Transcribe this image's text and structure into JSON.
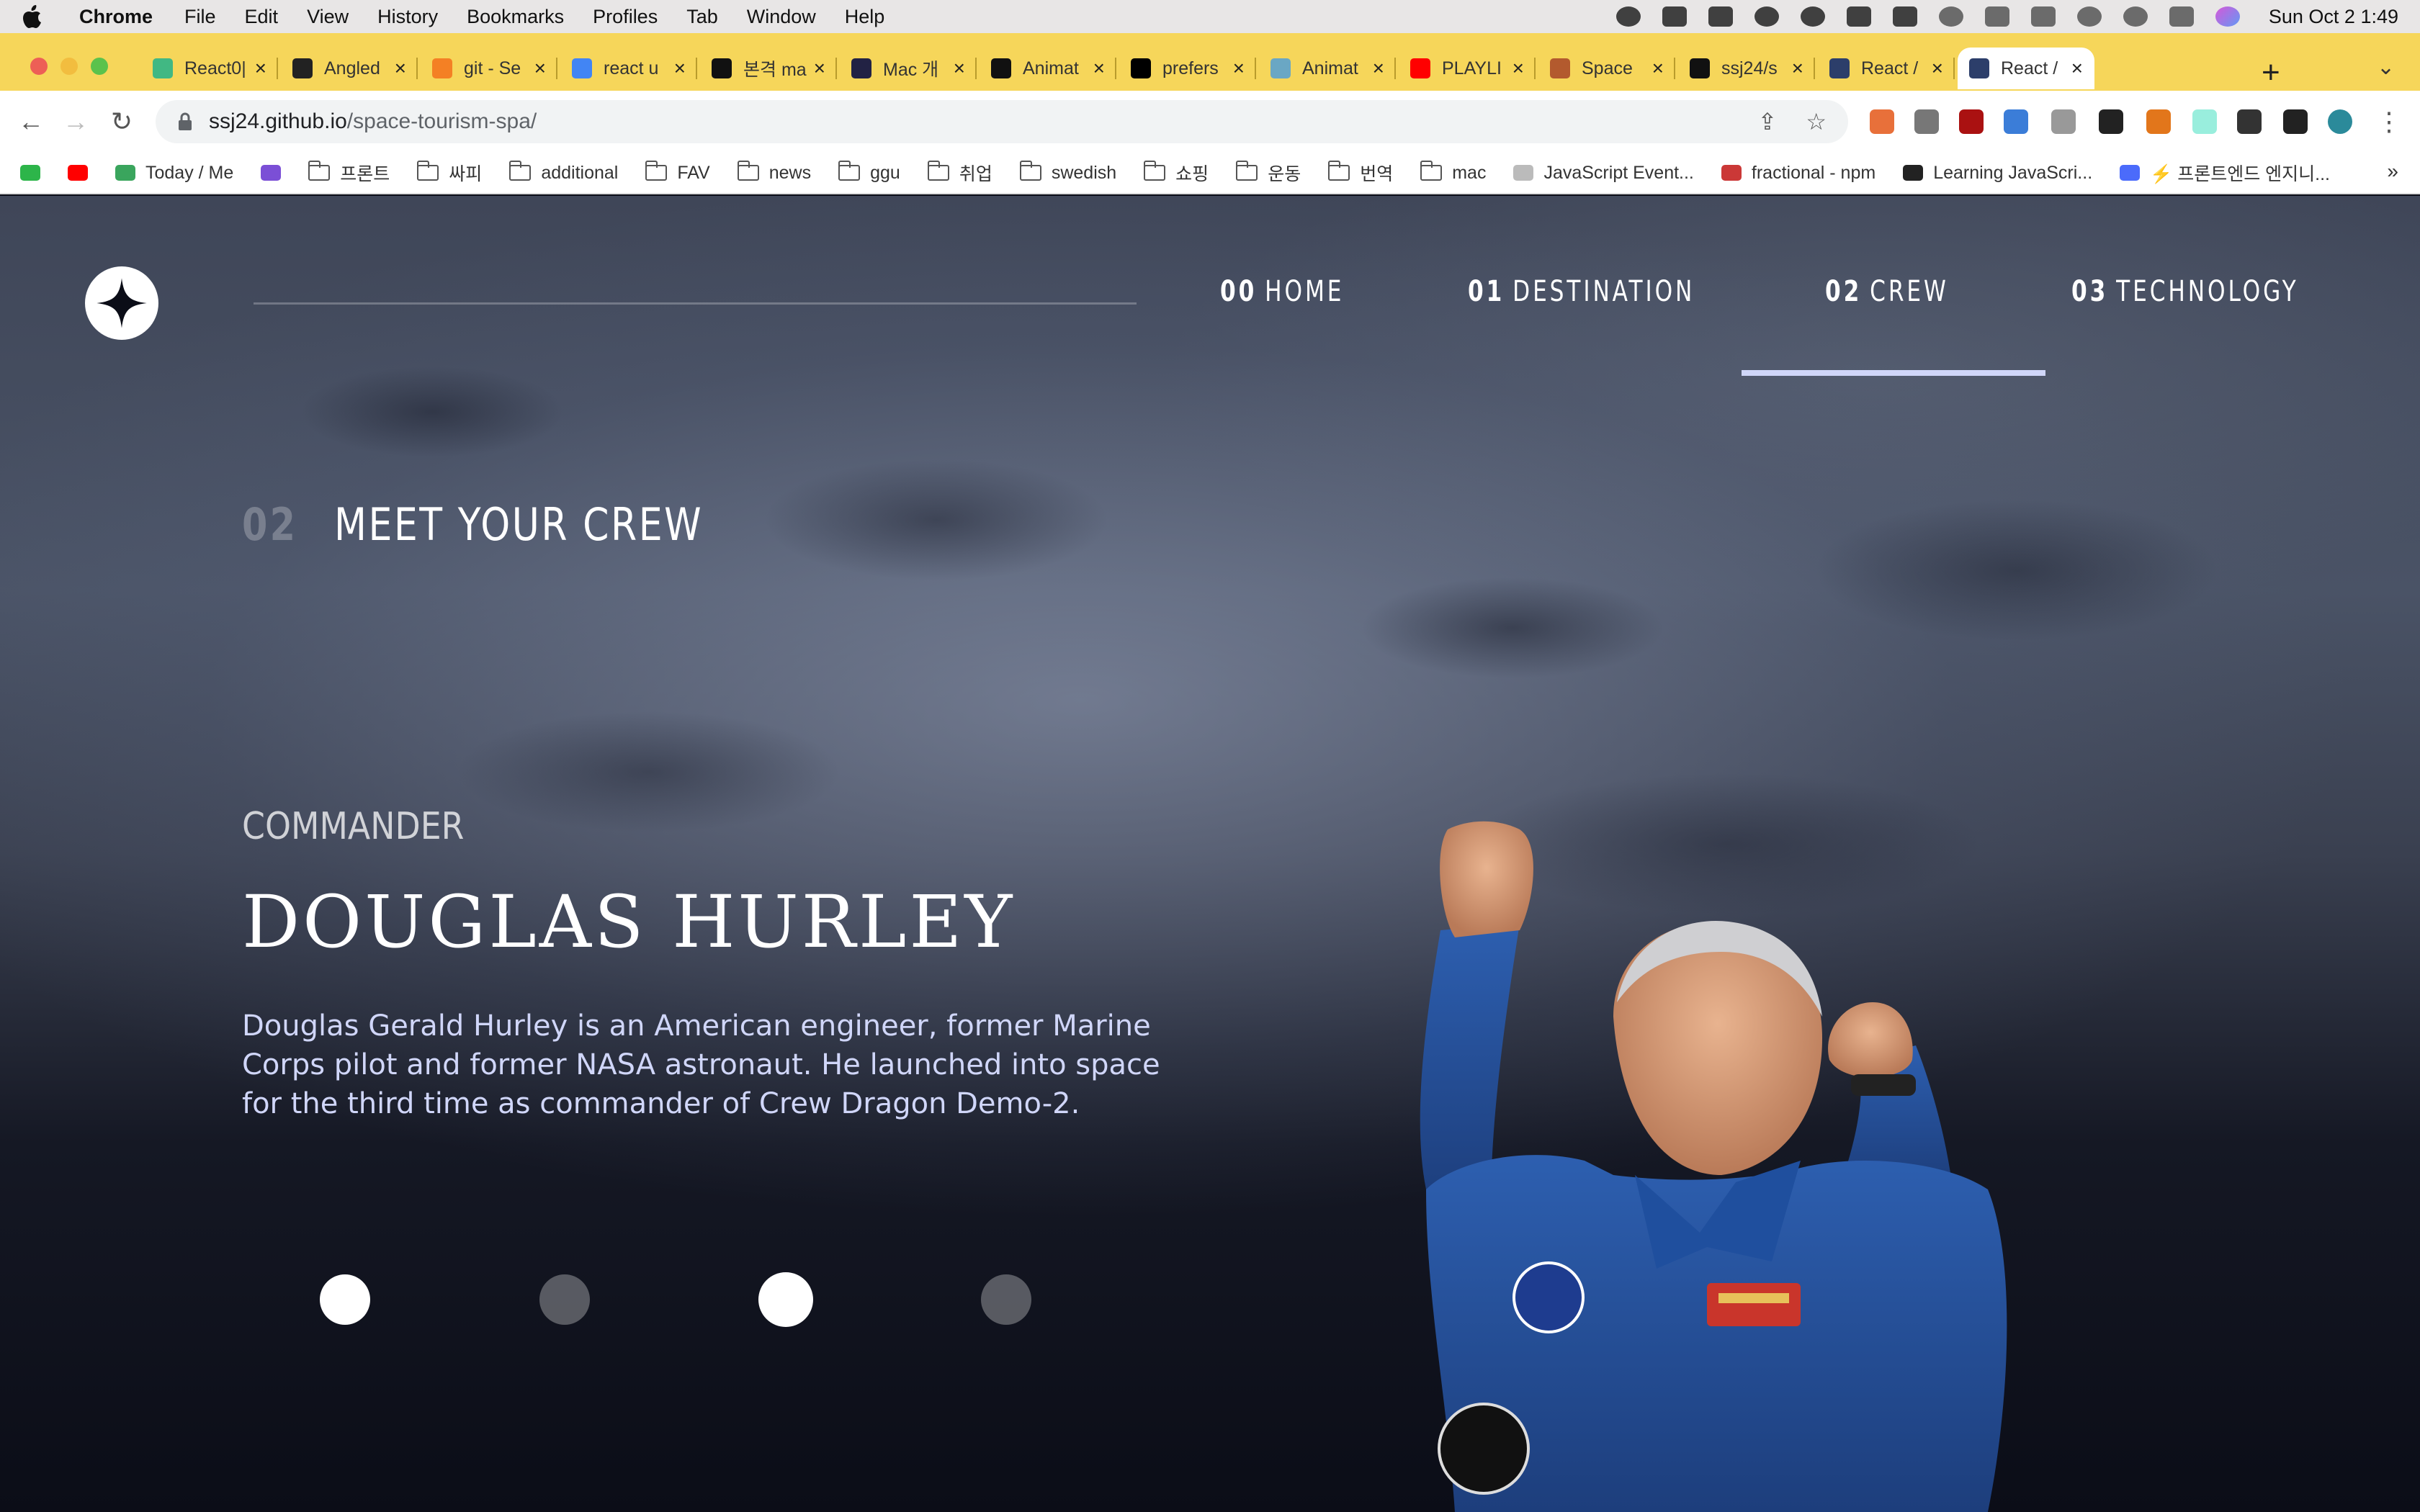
{
  "menubar": {
    "app": "Chrome",
    "items": [
      "File",
      "Edit",
      "View",
      "History",
      "Bookmarks",
      "Profiles",
      "Tab",
      "Window",
      "Help"
    ],
    "clock": "Sun Oct 2  1:49"
  },
  "tabs": [
    {
      "title": "React0|",
      "color": "#41b883"
    },
    {
      "title": "Angled",
      "color": "#222222"
    },
    {
      "title": "git - Se",
      "color": "#f48024"
    },
    {
      "title": "react u",
      "color": "#4285f4"
    },
    {
      "title": "본격 ma",
      "color": "#111111"
    },
    {
      "title": "Mac 개",
      "color": "#222244"
    },
    {
      "title": "Animat",
      "color": "#111111"
    },
    {
      "title": "prefers",
      "color": "#000000"
    },
    {
      "title": "Animat",
      "color": "#6aa7c4"
    },
    {
      "title": "PLAYLI",
      "color": "#ff0000"
    },
    {
      "title": "Space",
      "color": "#b35a2e"
    },
    {
      "title": "ssj24/s",
      "color": "#111111"
    },
    {
      "title": "React /",
      "color": "#2c3e6a"
    },
    {
      "title": "React /",
      "color": "#2c3e6a"
    }
  ],
  "toolbar": {
    "host": "ssj24.github.io",
    "path": "/space-tourism-spa/"
  },
  "bookmarks": [
    {
      "label": "",
      "type": "icon",
      "color": "#2db54a"
    },
    {
      "label": "",
      "type": "icon",
      "color": "#ff0000"
    },
    {
      "label": "Today / Me",
      "type": "icon",
      "color": "#3aa55d"
    },
    {
      "label": "",
      "type": "icon",
      "color": "#7b4fd6"
    },
    {
      "label": "프론트",
      "type": "folder"
    },
    {
      "label": "싸피",
      "type": "folder"
    },
    {
      "label": "additional",
      "type": "folder"
    },
    {
      "label": "FAV",
      "type": "folder"
    },
    {
      "label": "news",
      "type": "folder"
    },
    {
      "label": "ggu",
      "type": "folder"
    },
    {
      "label": "취업",
      "type": "folder"
    },
    {
      "label": "swedish",
      "type": "folder"
    },
    {
      "label": "쇼핑",
      "type": "folder"
    },
    {
      "label": "운동",
      "type": "folder"
    },
    {
      "label": "번역",
      "type": "folder"
    },
    {
      "label": "mac",
      "type": "folder"
    },
    {
      "label": "JavaScript Event...",
      "type": "icon",
      "color": "#bbbbbb"
    },
    {
      "label": "fractional - npm",
      "type": "icon",
      "color": "#cb3837"
    },
    {
      "label": "Learning JavaScri...",
      "type": "icon",
      "color": "#222222"
    },
    {
      "label": "⚡ 프론트엔드 엔지니...",
      "type": "icon",
      "color": "#4b6bfb"
    }
  ],
  "site": {
    "nav": [
      {
        "num": "00",
        "label": "HOME"
      },
      {
        "num": "01",
        "label": "DESTINATION"
      },
      {
        "num": "02",
        "label": "CREW"
      },
      {
        "num": "03",
        "label": "TECHNOLOGY"
      }
    ],
    "active_nav": "CREW",
    "section_num": "02",
    "section_title": "MEET YOUR CREW",
    "crew": {
      "role": "COMMANDER",
      "name": "DOUGLAS HURLEY",
      "bio": "Douglas Gerald Hurley is an American engineer, former Marine Corps pilot and former NASA astronaut. He launched into space for the third time as commander of Crew Dragon Demo-2."
    },
    "dots": [
      true,
      false,
      true,
      false
    ],
    "accent": "#d0d6f9"
  }
}
